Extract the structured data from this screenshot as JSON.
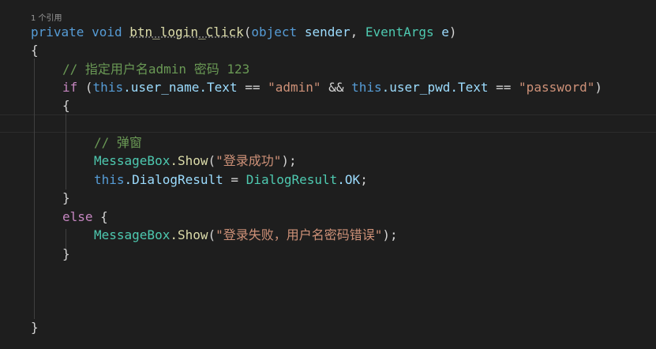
{
  "codelens": {
    "references": "1 个引用"
  },
  "code": {
    "line1": {
      "kw_private": "private",
      "kw_void": "void",
      "method": "btn_login_Click",
      "paren_open": "(",
      "kw_object": "object",
      "param_sender": "sender",
      "comma": ",",
      "type_eventargs": "EventArgs",
      "param_e": "e",
      "paren_close": ")"
    },
    "line2": {
      "brace": "{"
    },
    "line3": {
      "comment": "// 指定用户名admin 密码 123"
    },
    "line4": {
      "kw_if": "if",
      "paren_open": "(",
      "kw_this1": "this",
      "member1": ".user_name.Text",
      "eq1": "==",
      "str_admin": "\"admin\"",
      "and": "&&",
      "kw_this2": "this",
      "member2": ".user_pwd.Text",
      "eq2": "==",
      "str_password": "\"password\"",
      "paren_close": ")"
    },
    "line5": {
      "brace": "{"
    },
    "line7": {
      "comment": "// 弹窗"
    },
    "line8": {
      "type_messagebox": "MessageBox",
      "method_show": ".Show",
      "paren_open": "(",
      "str_success": "\"登录成功\"",
      "end": ");"
    },
    "line9": {
      "kw_this": "this",
      "member": ".DialogResult",
      "assign": "=",
      "type_dialogresult": "DialogResult",
      "member_ok": ".OK",
      "semicolon": ";"
    },
    "line10": {
      "brace": "}"
    },
    "line11": {
      "kw_else": "else",
      "brace": "{"
    },
    "line12": {
      "type_messagebox": "MessageBox",
      "method_show": ".Show",
      "paren_open": "(",
      "str_fail": "\"登录失败，用户名密码错误\"",
      "end": ");"
    },
    "line13": {
      "brace": "}"
    },
    "line18": {
      "brace": "}"
    }
  },
  "colors": {
    "background": "#1e1e1e",
    "keyword": "#569cd6",
    "control_keyword": "#c586c0",
    "function": "#dcdcaa",
    "type": "#4ec9b0",
    "identifier": "#9cdcfe",
    "string": "#ce9178",
    "comment": "#6a9955",
    "default_text": "#d4d4d4"
  }
}
